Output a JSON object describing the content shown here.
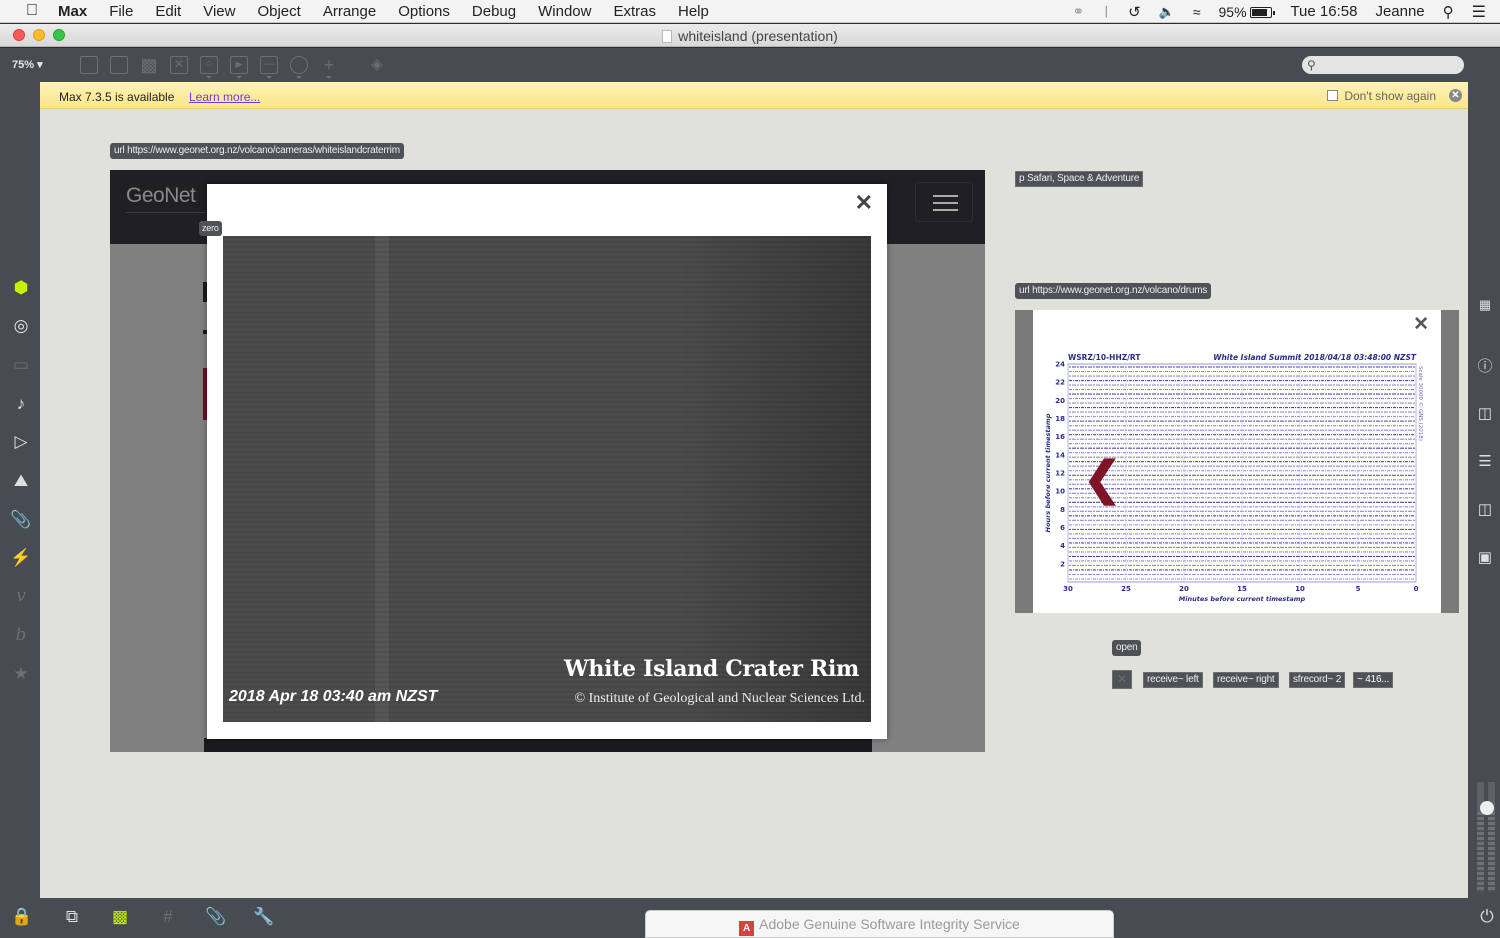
{
  "menubar": {
    "apple_icon": "apple-logo",
    "items": [
      "Max",
      "File",
      "Edit",
      "View",
      "Object",
      "Arrange",
      "Options",
      "Debug",
      "Window",
      "Extras",
      "Help"
    ],
    "status": {
      "battery": "95%",
      "clock": "Tue 16:58",
      "user": "Jeanne"
    }
  },
  "window": {
    "title": "whiteisland (presentation)"
  },
  "toolbar": {
    "zoom_level": "75%",
    "search_placeholder": ""
  },
  "banner": {
    "message": "Max 7.3.5 is available",
    "link": "Learn more...",
    "checkbox_label": "Don't show again",
    "checkbox_checked": false
  },
  "patch": {
    "url_camera": "url https://www.geonet.org.nz/volcano/cameras/whiteislandcraterrim",
    "url_drums": "url https://www.geonet.org.nz/volcano/drums",
    "preset_label": "p Safari, Space & Adventure",
    "zero_label": "zero",
    "open_label": "open",
    "objects": [
      "receive~ left",
      "receive~ right",
      "sfrecord~ 2",
      "~ 416..."
    ]
  },
  "geonet": {
    "logo": "GeoNet",
    "camera": {
      "title": "White Island Crater Rim",
      "copyright": "© Institute of Geological and Nuclear Sciences Ltd.",
      "timestamp": "2018 Apr 18 03:40 am NZST"
    }
  },
  "chart_data": {
    "type": "line",
    "title": "White Island Summit   2018/04/18 03:48:00 NZST",
    "station": "WSRZ/10-HHZ/RT",
    "side_note": "Scale 30000 © GNS (2018)",
    "xlabel": "Minutes before current timestamp",
    "ylabel": "Hours before current timestamp",
    "xlim": [
      30,
      0
    ],
    "ylim": [
      0,
      24
    ],
    "x_ticks": [
      30,
      25,
      20,
      15,
      10,
      5,
      0
    ],
    "y_ticks": [
      2,
      4,
      6,
      8,
      10,
      12,
      14,
      16,
      18,
      20,
      22,
      24
    ],
    "grid": true
  },
  "notification": {
    "text": "Adobe Genuine Software Integrity Service"
  }
}
